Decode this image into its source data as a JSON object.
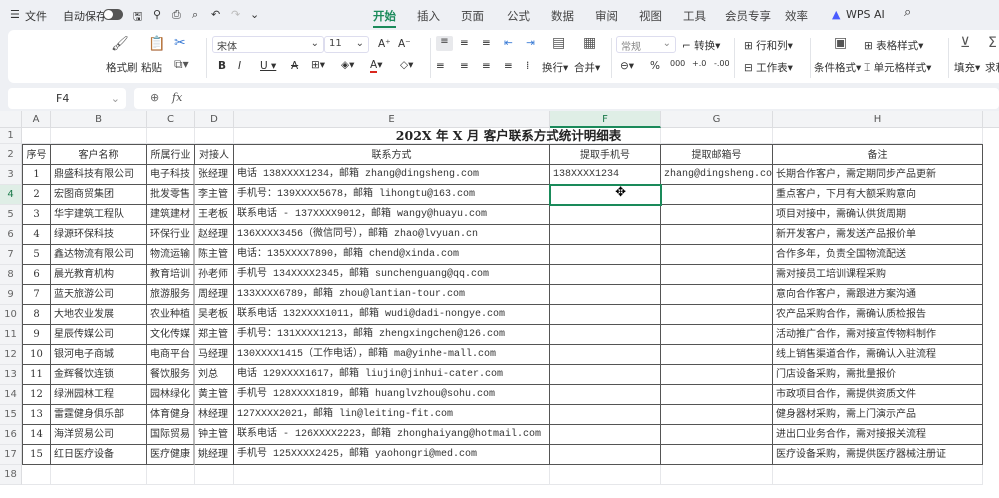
{
  "topbar": {
    "menu_label": "文件",
    "autosave_label": "自动保存",
    "autosave_on": false,
    "tabs": [
      "开始",
      "插入",
      "页面",
      "公式",
      "数据",
      "审阅",
      "视图",
      "工具",
      "会员专享",
      "效率"
    ],
    "active_tab": "开始",
    "ai_label": "WPS AI"
  },
  "ribbon": {
    "format_painter": "格式刷",
    "paste": "粘贴",
    "font_name": "宋体",
    "font_size": "11",
    "wrap": "换行",
    "merge": "合并",
    "number_format": "常规",
    "convert": "转换",
    "rows_cols": "行和列",
    "worksheet": "工作表",
    "cond_format": "条件格式",
    "table_style": "表格样式",
    "cell_style": "单元格样式",
    "fill": "填充",
    "sum": "求和",
    "font_color": "#d9281e"
  },
  "formula_bar": {
    "cell_ref": "F4",
    "fx": "fx",
    "value": ""
  },
  "sheet": {
    "columns": [
      "A",
      "B",
      "C",
      "D",
      "E",
      "F",
      "G",
      "H"
    ],
    "selected_column": "F",
    "selected_row": 4,
    "title": "202X 年 X 月 客户联系方式统计明细表",
    "headers": [
      "序号",
      "客户名称",
      "所属行业",
      "对接人",
      "联系方式",
      "提取手机号",
      "提取邮箱号",
      "备注"
    ],
    "rows": [
      [
        "1",
        "鼎盛科技有限公司",
        "电子科技",
        "张经理",
        "电话 138XXXX1234，邮箱 zhang@dingsheng.com",
        "138XXXX1234",
        "zhang@dingsheng.com",
        "长期合作客户，需定期同步产品更新"
      ],
      [
        "2",
        "宏图商贸集团",
        "批发零售",
        "李主管",
        "手机号：139XXXX5678，邮箱 lihongtu@163.com",
        "",
        "",
        "重点客户，下月有大额采购意向"
      ],
      [
        "3",
        "华宇建筑工程队",
        "建筑建材",
        "王老板",
        "联系电话 - 137XXXX9012，邮箱 wangy@huayu.com",
        "",
        "",
        "项目对接中，需确认供货周期"
      ],
      [
        "4",
        "绿源环保科技",
        "环保行业",
        "赵经理",
        "136XXXX3456（微信同号），邮箱 zhao@lvyuan.cn",
        "",
        "",
        "新开发客户，需发送产品报价单"
      ],
      [
        "5",
        "鑫达物流有限公司",
        "物流运输",
        "陈主管",
        "电话：135XXXX7890，邮箱 chend@xinda.com",
        "",
        "",
        "合作多年，负责全国物流配送"
      ],
      [
        "6",
        "晨光教育机构",
        "教育培训",
        "孙老师",
        "手机号 134XXXX2345，邮箱 sunchenguang@qq.com",
        "",
        "",
        "需对接员工培训课程采购"
      ],
      [
        "7",
        "蓝天旅游公司",
        "旅游服务",
        "周经理",
        "133XXXX6789，邮箱 zhou@lantian-tour.com",
        "",
        "",
        "意向合作客户，需跟进方案沟通"
      ],
      [
        "8",
        "大地农业发展",
        "农业种植",
        "吴老板",
        "联系电话 132XXXX1011，邮箱 wudi@dadi-nongye.com",
        "",
        "",
        "农产品采购合作，需确认质检报告"
      ],
      [
        "9",
        "星辰传媒公司",
        "文化传媒",
        "郑主管",
        "手机号：131XXXX1213，邮箱 zhengxingchen@126.com",
        "",
        "",
        "活动推广合作，需对接宣传物料制作"
      ],
      [
        "10",
        "银河电子商城",
        "电商平台",
        "马经理",
        "130XXXX1415（工作电话），邮箱 ma@yinhe-mall.com",
        "",
        "",
        "线上销售渠道合作，需确认入驻流程"
      ],
      [
        "11",
        "金辉餐饮连锁",
        "餐饮服务",
        "刘总",
        "电话 129XXXX1617，邮箱 liujin@jinhui-cater.com",
        "",
        "",
        "门店设备采购，需批量报价"
      ],
      [
        "12",
        "绿洲园林工程",
        "园林绿化",
        "黄主管",
        "手机号 128XXXX1819，邮箱 huanglvzhou@sohu.com",
        "",
        "",
        "市政项目合作，需提供资质文件"
      ],
      [
        "13",
        "雷霆健身俱乐部",
        "体育健身",
        "林经理",
        "127XXXX2021，邮箱 lin@leiting-fit.com",
        "",
        "",
        "健身器材采购，需上门演示产品"
      ],
      [
        "14",
        "海洋贸易公司",
        "国际贸易",
        "钟主管",
        "联系电话 - 126XXXX2223，邮箱 zhonghaiyang@hotmail.com",
        "",
        "",
        "进出口业务合作，需对接报关流程"
      ],
      [
        "15",
        "红日医疗设备",
        "医疗健康",
        "姚经理",
        "手机号 125XXXX2425，邮箱 yaohongri@med.com",
        "",
        "",
        "医疗设备采购，需提供医疗器械注册证"
      ]
    ]
  }
}
